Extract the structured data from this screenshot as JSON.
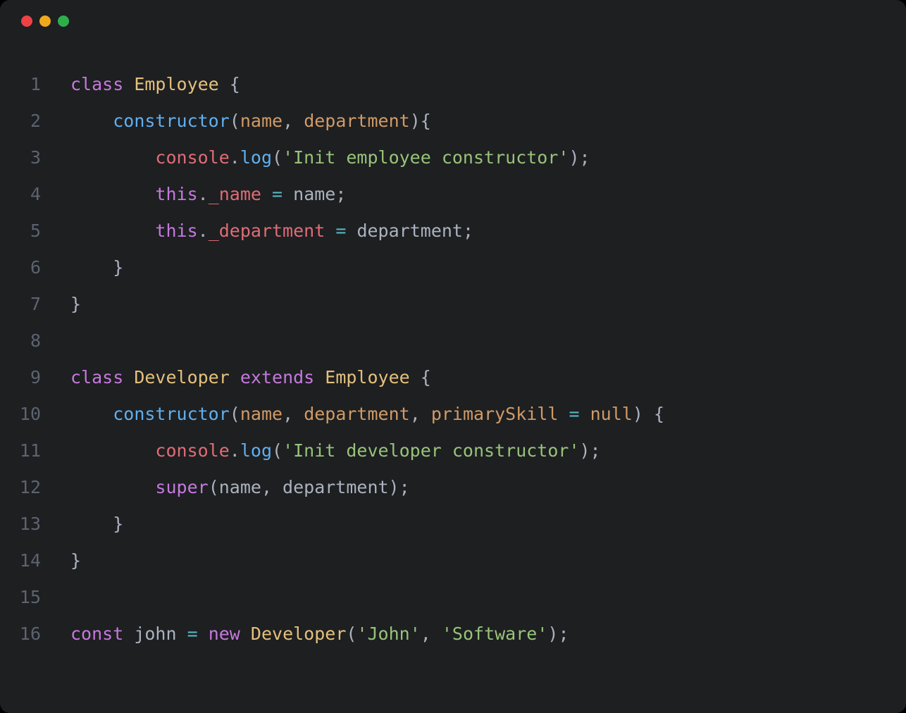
{
  "window": {
    "traffic_lights": [
      "red",
      "yellow",
      "green"
    ]
  },
  "editor": {
    "line_numbers": [
      "1",
      "2",
      "3",
      "4",
      "5",
      "6",
      "7",
      "8",
      "9",
      "10",
      "11",
      "12",
      "13",
      "14",
      "15",
      "16"
    ],
    "lines": [
      {
        "indent": 0,
        "tokens": [
          {
            "cls": "kw",
            "t": "class"
          },
          {
            "cls": "pln",
            "t": " "
          },
          {
            "cls": "cls",
            "t": "Employee"
          },
          {
            "cls": "pln",
            "t": " {"
          }
        ]
      },
      {
        "indent": 1,
        "tokens": [
          {
            "cls": "fn",
            "t": "constructor"
          },
          {
            "cls": "pln",
            "t": "("
          },
          {
            "cls": "prm",
            "t": "name"
          },
          {
            "cls": "pln",
            "t": ", "
          },
          {
            "cls": "prm",
            "t": "department"
          },
          {
            "cls": "pln",
            "t": "){"
          }
        ]
      },
      {
        "indent": 2,
        "tokens": [
          {
            "cls": "obj",
            "t": "console"
          },
          {
            "cls": "pln",
            "t": "."
          },
          {
            "cls": "fn",
            "t": "log"
          },
          {
            "cls": "pln",
            "t": "("
          },
          {
            "cls": "str",
            "t": "'Init employee constructor'"
          },
          {
            "cls": "pln",
            "t": ");"
          }
        ]
      },
      {
        "indent": 2,
        "tokens": [
          {
            "cls": "kw",
            "t": "this"
          },
          {
            "cls": "pln",
            "t": "."
          },
          {
            "cls": "obj",
            "t": "_name"
          },
          {
            "cls": "pln",
            "t": " "
          },
          {
            "cls": "op",
            "t": "="
          },
          {
            "cls": "pln",
            "t": " name;"
          }
        ]
      },
      {
        "indent": 2,
        "tokens": [
          {
            "cls": "kw",
            "t": "this"
          },
          {
            "cls": "pln",
            "t": "."
          },
          {
            "cls": "obj",
            "t": "_department"
          },
          {
            "cls": "pln",
            "t": " "
          },
          {
            "cls": "op",
            "t": "="
          },
          {
            "cls": "pln",
            "t": " department;"
          }
        ]
      },
      {
        "indent": 1,
        "tokens": [
          {
            "cls": "pln",
            "t": "}"
          }
        ]
      },
      {
        "indent": 0,
        "tokens": [
          {
            "cls": "pln",
            "t": "}"
          }
        ]
      },
      {
        "indent": 0,
        "tokens": []
      },
      {
        "indent": 0,
        "tokens": [
          {
            "cls": "kw",
            "t": "class"
          },
          {
            "cls": "pln",
            "t": " "
          },
          {
            "cls": "cls",
            "t": "Developer"
          },
          {
            "cls": "pln",
            "t": " "
          },
          {
            "cls": "kw",
            "t": "extends"
          },
          {
            "cls": "pln",
            "t": " "
          },
          {
            "cls": "cls",
            "t": "Employee"
          },
          {
            "cls": "pln",
            "t": " {"
          }
        ]
      },
      {
        "indent": 1,
        "tokens": [
          {
            "cls": "fn",
            "t": "constructor"
          },
          {
            "cls": "pln",
            "t": "("
          },
          {
            "cls": "prm",
            "t": "name"
          },
          {
            "cls": "pln",
            "t": ", "
          },
          {
            "cls": "prm",
            "t": "department"
          },
          {
            "cls": "pln",
            "t": ", "
          },
          {
            "cls": "prm",
            "t": "primarySkill"
          },
          {
            "cls": "pln",
            "t": " "
          },
          {
            "cls": "op",
            "t": "="
          },
          {
            "cls": "pln",
            "t": " "
          },
          {
            "cls": "prm",
            "t": "null"
          },
          {
            "cls": "pln",
            "t": ") {"
          }
        ]
      },
      {
        "indent": 2,
        "tokens": [
          {
            "cls": "obj",
            "t": "console"
          },
          {
            "cls": "pln",
            "t": "."
          },
          {
            "cls": "fn",
            "t": "log"
          },
          {
            "cls": "pln",
            "t": "("
          },
          {
            "cls": "str",
            "t": "'Init developer constructor'"
          },
          {
            "cls": "pln",
            "t": ");"
          }
        ]
      },
      {
        "indent": 2,
        "tokens": [
          {
            "cls": "kw",
            "t": "super"
          },
          {
            "cls": "pln",
            "t": "(name, department);"
          }
        ]
      },
      {
        "indent": 1,
        "tokens": [
          {
            "cls": "pln",
            "t": "}"
          }
        ]
      },
      {
        "indent": 0,
        "tokens": [
          {
            "cls": "pln",
            "t": "}"
          }
        ]
      },
      {
        "indent": 0,
        "tokens": []
      },
      {
        "indent": 0,
        "tokens": [
          {
            "cls": "kw",
            "t": "const"
          },
          {
            "cls": "pln",
            "t": " john "
          },
          {
            "cls": "op",
            "t": "="
          },
          {
            "cls": "pln",
            "t": " "
          },
          {
            "cls": "kw",
            "t": "new"
          },
          {
            "cls": "pln",
            "t": " "
          },
          {
            "cls": "cls",
            "t": "Developer"
          },
          {
            "cls": "pln",
            "t": "("
          },
          {
            "cls": "str",
            "t": "'John'"
          },
          {
            "cls": "pln",
            "t": ", "
          },
          {
            "cls": "str",
            "t": "'Software'"
          },
          {
            "cls": "pln",
            "t": ");"
          }
        ]
      }
    ],
    "indent_unit": "    "
  }
}
